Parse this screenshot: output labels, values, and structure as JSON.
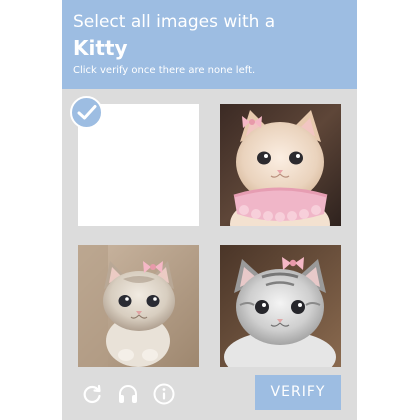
{
  "header": {
    "prompt": "Select all images with a",
    "target": "Kitty",
    "instruction": "Click verify once there are none left."
  },
  "grid": {
    "tiles": [
      {
        "content": "blank",
        "selected": true
      },
      {
        "content": "kitten-with-bow-and-collar-image",
        "selected": false
      },
      {
        "content": "kitten-with-bow-image",
        "selected": false
      },
      {
        "content": "gray-kitten-with-bow-image",
        "selected": false
      }
    ]
  },
  "footer": {
    "icons": [
      "reload-icon",
      "headphones-icon",
      "info-icon"
    ],
    "verify_label": "VERIFY"
  },
  "colors": {
    "accent": "#9dbde2",
    "panel_background": "#dcdcdc",
    "text_on_accent": "#ffffff"
  }
}
